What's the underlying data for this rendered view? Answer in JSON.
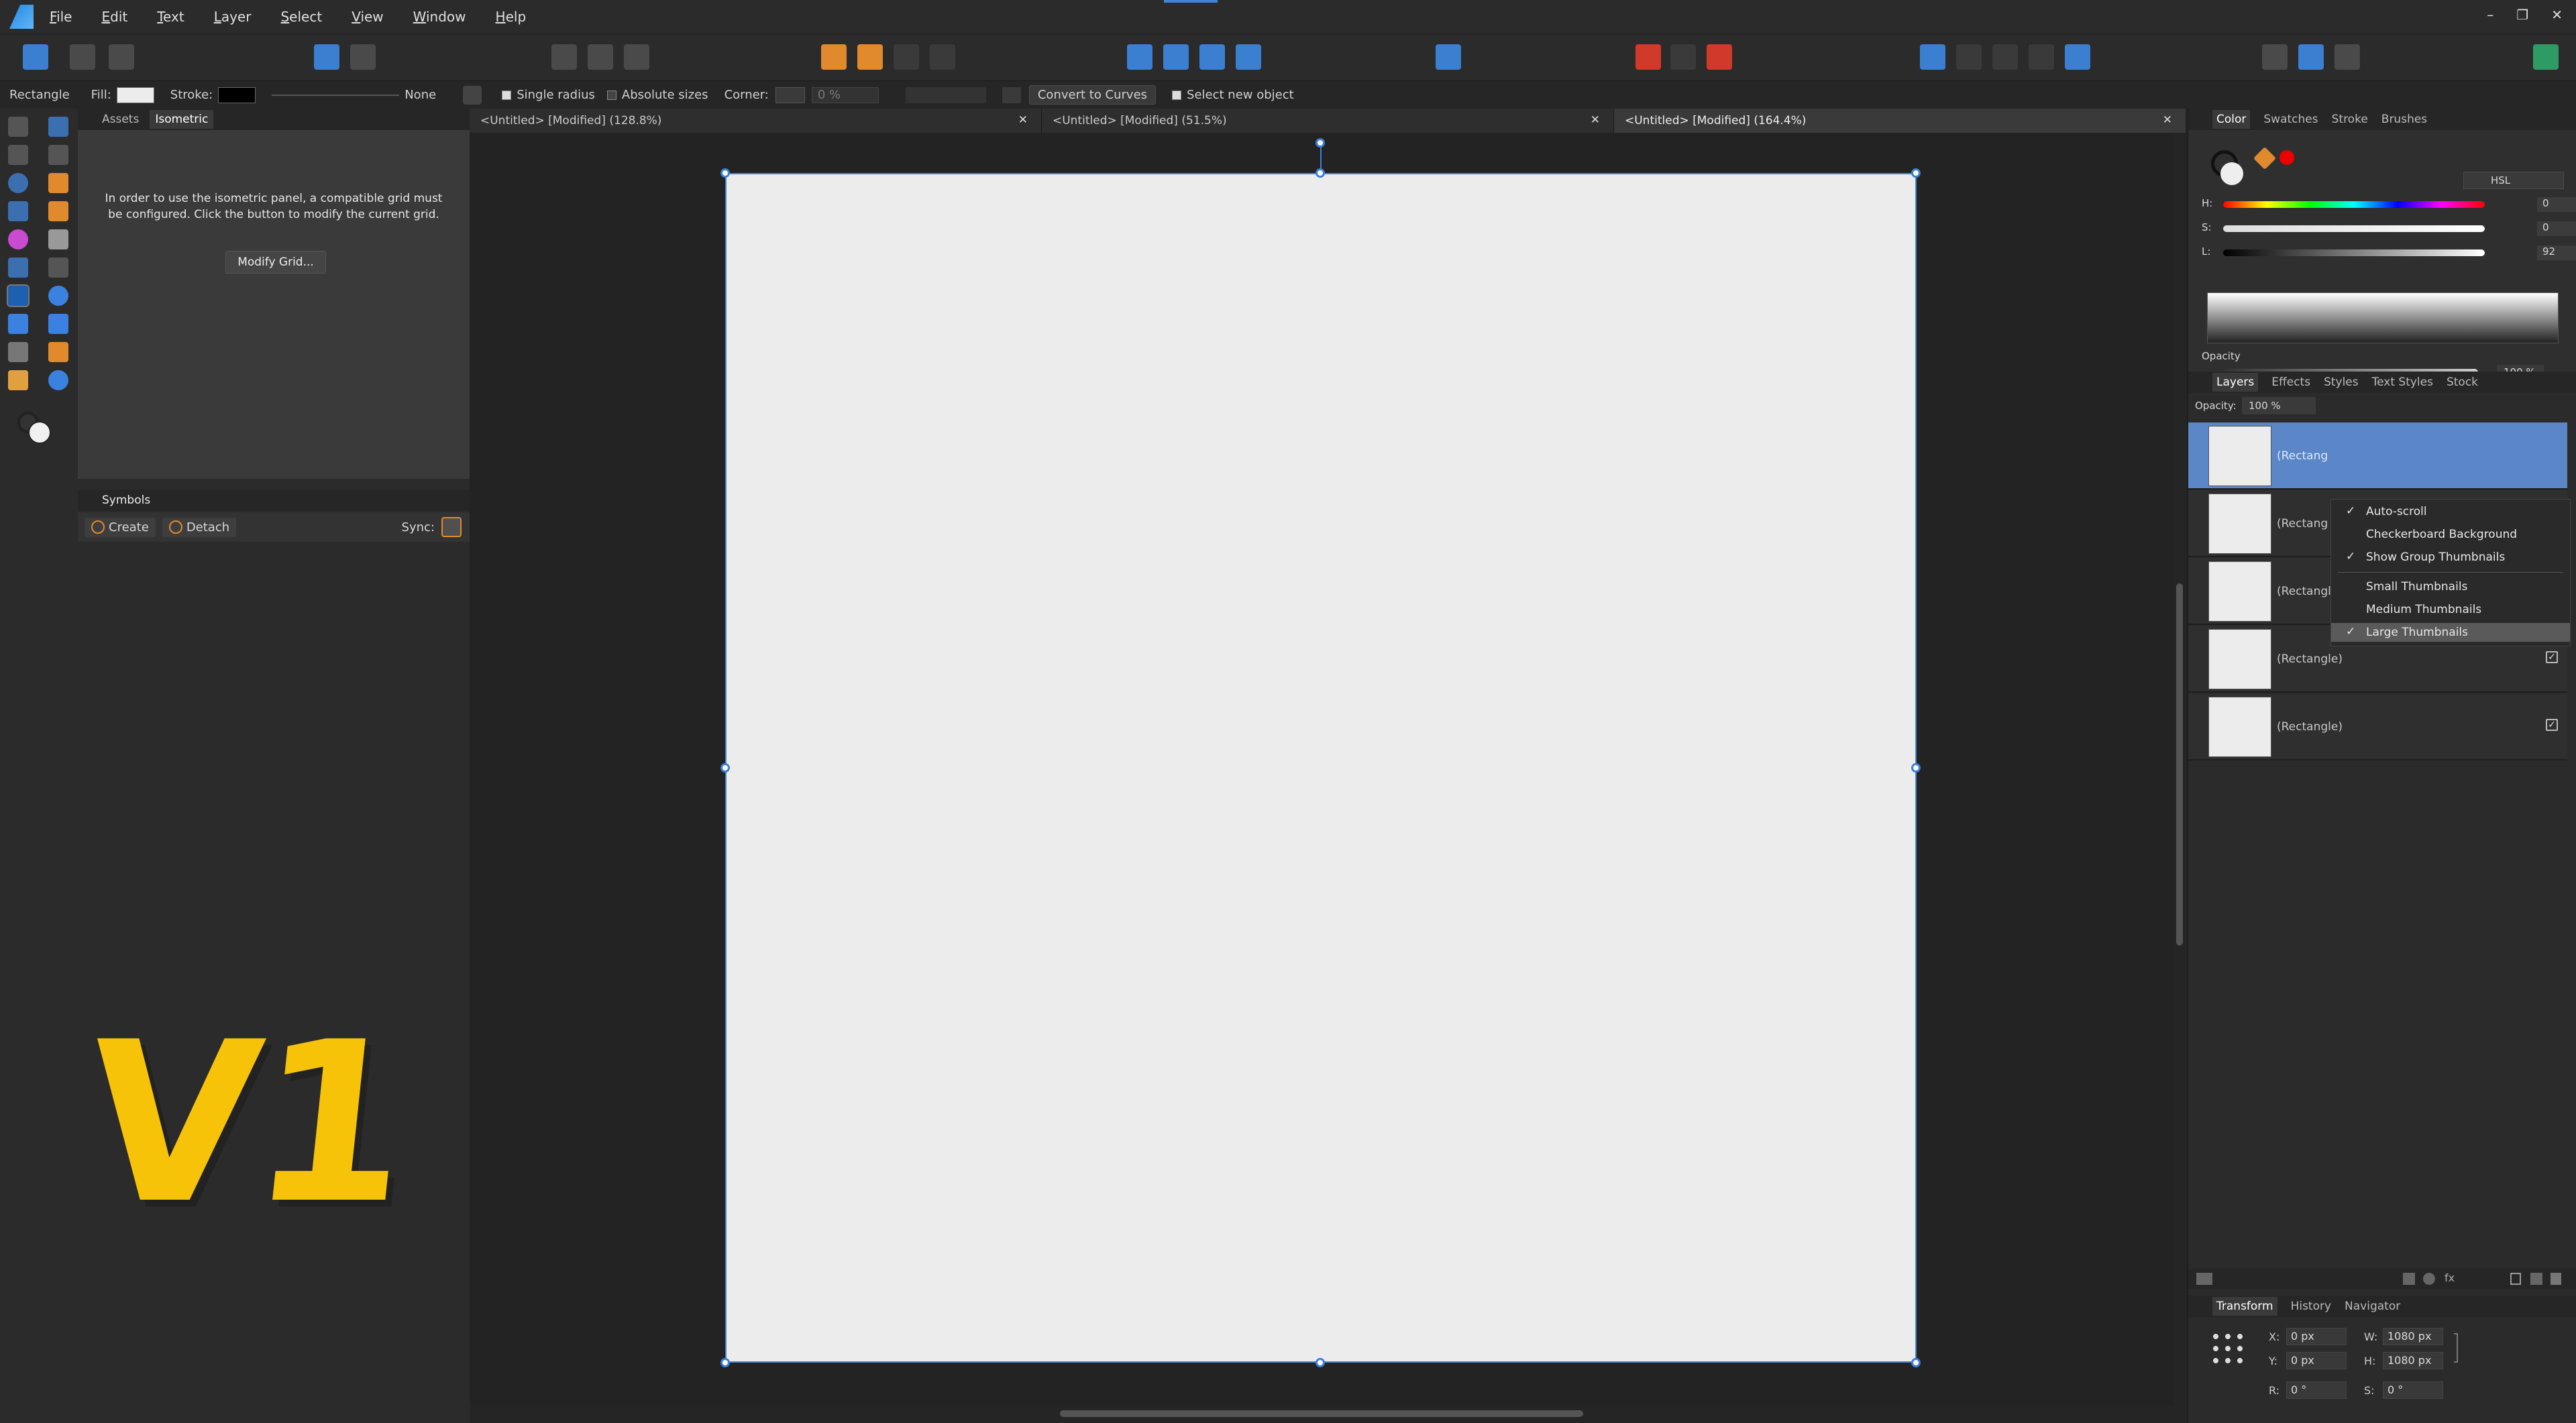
{
  "menu": [
    "File",
    "Edit",
    "Text",
    "Layer",
    "Select",
    "View",
    "Window",
    "Help"
  ],
  "window_controls": [
    "–",
    "❐",
    "✕"
  ],
  "context_toolbar": {
    "tool_name": "Rectangle",
    "fill_label": "Fill:",
    "stroke_label": "Stroke:",
    "stroke_value": "None",
    "single_radius": "Single radius",
    "absolute_sizes": "Absolute sizes",
    "corner_label": "Corner:",
    "corner_value": "0 %",
    "convert_to_curves": "Convert to Curves",
    "select_new_object": "Select new object"
  },
  "left_panel": {
    "tabs": [
      "Assets",
      "Isometric"
    ],
    "iso_message": "In order to use the isometric panel, a compatible grid must be configured. Click the button to modify the current grid.",
    "modify_grid": "Modify Grid...",
    "symbols_title": "Symbols",
    "create": "Create",
    "detach": "Detach",
    "sync": "Sync:"
  },
  "overlay_text": "V1",
  "doc_tabs": [
    "<Untitled> [Modified] (128.8%)",
    "<Untitled> [Modified] (51.5%)",
    "<Untitled> [Modified] (164.4%)"
  ],
  "color_panel": {
    "tabs": [
      "Color",
      "Swatches",
      "Stroke",
      "Brushes"
    ],
    "model": "HSL",
    "h_label": "H:",
    "h_value": "0",
    "s_label": "S:",
    "s_value": "0",
    "l_label": "L:",
    "l_value": "92",
    "opacity_label": "Opacity",
    "opacity_value": "100 %"
  },
  "layers_panel": {
    "tabs": [
      "Layers",
      "Effects",
      "Styles",
      "Text Styles",
      "Stock"
    ],
    "opacity_label": "Opacity:",
    "opacity_value": "100 %",
    "layers": [
      "(Rectangle)",
      "(Rectangle)",
      "(Rectangle)",
      "(Rectangle)",
      "(Rectangle)"
    ],
    "selected_layer_label": "(Rectang",
    "context_menu": [
      "Auto-scroll",
      "Checkerboard Background",
      "Show Group Thumbnails",
      "Small Thumbnails",
      "Medium Thumbnails",
      "Large Thumbnails"
    ],
    "checkmark": "✓"
  },
  "transform_panel": {
    "tabs": [
      "Transform",
      "History",
      "Navigator"
    ],
    "x_label": "X:",
    "x_value": "0 px",
    "y_label": "Y:",
    "y_value": "0 px",
    "w_label": "W:",
    "w_value": "1080 px",
    "h_label": "H:",
    "h_value": "1080 px",
    "r_label": "R:",
    "r_value": "0 °",
    "s_label": "S:",
    "s_value": "0 °"
  },
  "colors": {
    "accent": "#3d7fd6",
    "overlay": "#f6c309",
    "selected_layer": "#5b86c7"
  }
}
